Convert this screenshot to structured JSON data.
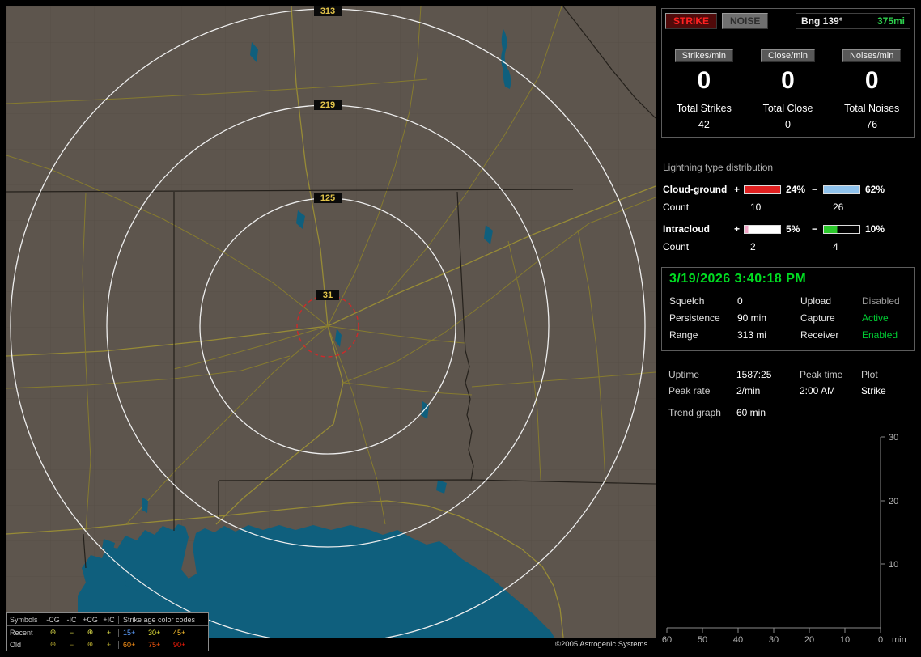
{
  "colors": {
    "accent_green": "#00cc33",
    "timestamp_green": "#00dd22",
    "strike_red": "#ff2222",
    "disabled_gray": "#9a9a9a",
    "map_land": "#5d554d",
    "map_water": "#0f5f7d",
    "range_ring_white": "#eeeeee",
    "alarm_ring_red": "#cc2a2a",
    "road_yellow": "#867b2f",
    "range_label_yellow": "#e2c44a"
  },
  "map": {
    "range_labels": [
      "313",
      "219",
      "125",
      "31"
    ],
    "legend": {
      "symbols_header": "Symbols",
      "symbol_columns": [
        "-CG",
        "-IC",
        "+CG",
        "+IC"
      ],
      "age_header": "Strike age color codes",
      "symbols": {
        "neg_cg": "⊖",
        "neg_ic": "−",
        "pos_cg": "⊕",
        "pos_ic": "+"
      },
      "rows": [
        {
          "label": "Recent",
          "symbol_color": "#d8d848",
          "ages": [
            {
              "text": "15+",
              "color": "#5c9eff"
            },
            {
              "text": "30+",
              "color": "#e6e63a"
            },
            {
              "text": "45+",
              "color": "#ffc22e"
            }
          ]
        },
        {
          "label": "Old",
          "symbol_color": "#aca02c",
          "ages": [
            {
              "text": "60+",
              "color": "#ff9418"
            },
            {
              "text": "75+",
              "color": "#ff5a10"
            },
            {
              "text": "90+",
              "color": "#ff1e0a"
            }
          ]
        }
      ]
    },
    "copyright": "©2005 Astrogenic Systems"
  },
  "panel": {
    "strike_button": "STRIKE",
    "noise_button": "NOISE",
    "bearing_label": "Bng 139°",
    "bearing_distance": "375mi",
    "rates": [
      {
        "label": "Strikes/min",
        "value": "0",
        "total_label": "Total Strikes",
        "total": "42"
      },
      {
        "label": "Close/min",
        "value": "0",
        "total_label": "Total Close",
        "total": "0"
      },
      {
        "label": "Noises/min",
        "value": "0",
        "total_label": "Total Noises",
        "total": "76"
      }
    ],
    "distribution": {
      "header": "Lightning type distribution",
      "rows": [
        {
          "label": "Cloud-ground",
          "plus_sign": "+",
          "minus_sign": "−",
          "plus_pct": "24%",
          "minus_pct": "62%",
          "plus_bar": "background:#e02020",
          "minus_bar": "background:#8fc2ec",
          "count_label": "Count",
          "plus_count": "10",
          "minus_count": "26"
        },
        {
          "label": "Intracloud",
          "plus_sign": "+",
          "minus_sign": "−",
          "plus_pct": "5%",
          "minus_pct": "10%",
          "plus_bar": "background:linear-gradient(to right,#f2a6c6 10%,#ffffff 10%)",
          "minus_bar": "background:linear-gradient(to right,#2cc82c 38%,#000000 38%)",
          "count_label": "Count",
          "plus_count": "2",
          "minus_count": "4"
        }
      ]
    },
    "status": {
      "timestamp": "3/19/2026 3:40:18 PM",
      "fields": [
        {
          "label": "Squelch",
          "value": "0",
          "color": "#ffffff"
        },
        {
          "label": "Upload",
          "value": "Disabled",
          "color": "#9a9a9a"
        },
        {
          "label": "Persistence",
          "value": "90 min",
          "color": "#ffffff"
        },
        {
          "label": "Capture",
          "value": "Active",
          "color": "#00cc33"
        },
        {
          "label": "Range",
          "value": "313 mi",
          "color": "#ffffff"
        },
        {
          "label": "Receiver",
          "value": "Enabled",
          "color": "#00cc33"
        }
      ]
    },
    "stats": {
      "cells": [
        [
          "Uptime",
          "1587:25",
          "Peak time",
          "Plot"
        ],
        [
          "Peak rate",
          "2/min",
          "2:00 AM",
          "Strike"
        ]
      ],
      "trend_label": "Trend graph",
      "trend_value": "60 min"
    },
    "trend_graph": {
      "y_ticks": [
        "30",
        "20",
        "10"
      ],
      "x_ticks": [
        "60",
        "50",
        "40",
        "30",
        "20",
        "10",
        "0"
      ],
      "x_unit": "min"
    }
  }
}
